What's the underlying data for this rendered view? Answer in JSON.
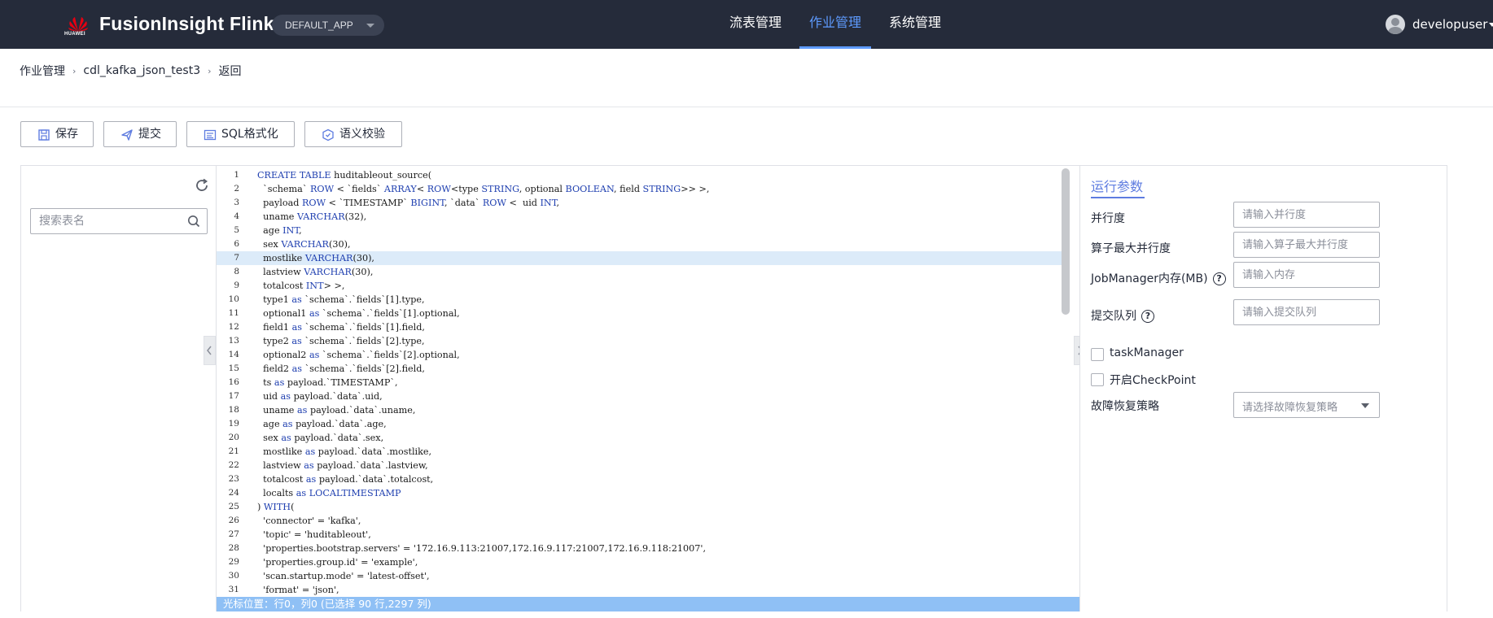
{
  "header": {
    "logo_text": "HUAWEI",
    "brand": "FusionInsight Flink",
    "app_selector": "DEFAULT_APP",
    "nav": [
      {
        "label": "流表管理",
        "active": false
      },
      {
        "label": "作业管理",
        "active": true
      },
      {
        "label": "系统管理",
        "active": false
      }
    ],
    "user": "developuser",
    "brand_color": "#252b3a",
    "accent_color": "#5e9bff"
  },
  "breadcrumb": [
    "作业管理",
    "cdl_kafka_json_test3",
    "返回"
  ],
  "toolbar": {
    "save": "保存",
    "submit": "提交",
    "sql_format": "SQL格式化",
    "semantic_check": "语义校验"
  },
  "left_panel": {
    "search_placeholder": "搜索表名"
  },
  "editor": {
    "highlighted_line": 7,
    "lines": [
      "CREATE TABLE huditableout_source(",
      "  `schema` ROW < `fields` ARRAY< ROW<type STRING, optional BOOLEAN, field STRING>> >,",
      "  payload ROW < `TIMESTAMP` BIGINT, `data` ROW <  uid INT,",
      "  uname VARCHAR(32),",
      "  age INT,",
      "  sex VARCHAR(30),",
      "  mostlike VARCHAR(30),",
      "  lastview VARCHAR(30),",
      "  totalcost INT> >,",
      "  type1 as `schema`.`fields`[1].type,",
      "  optional1 as `schema`.`fields`[1].optional,",
      "  field1 as `schema`.`fields`[1].field,",
      "  type2 as `schema`.`fields`[2].type,",
      "  optional2 as `schema`.`fields`[2].optional,",
      "  field2 as `schema`.`fields`[2].field,",
      "  ts as payload.`TIMESTAMP`,",
      "  uid as payload.`data`.uid,",
      "  uname as payload.`data`.uname,",
      "  age as payload.`data`.age,",
      "  sex as payload.`data`.sex,",
      "  mostlike as payload.`data`.mostlike,",
      "  lastview as payload.`data`.lastview,",
      "  totalcost as payload.`data`.totalcost,",
      "  localts as LOCALTIMESTAMP",
      ") WITH(",
      "  'connector' = 'kafka',",
      "  'topic' = 'huditableout',",
      "  'properties.bootstrap.servers' = '172.16.9.113:21007,172.16.9.117:21007,172.16.9.118:21007',",
      "  'properties.group.id' = 'example',",
      "  'scan.startup.mode' = 'latest-offset',",
      "  'format' = 'json',"
    ],
    "status": "光标位置：行0，列0 (已选择 90 行,2297 列)"
  },
  "run_params": {
    "title": "运行参数",
    "parallelism_label": "并行度",
    "parallelism_placeholder": "请输入并行度",
    "max_parallelism_label": "算子最大并行度",
    "max_parallelism_placeholder": "请输入算子最大并行度",
    "jm_memory_label": "JobManager内存(MB)",
    "jm_memory_placeholder": "请输入内存",
    "queue_label": "提交队列",
    "queue_placeholder": "请输入提交队列",
    "task_manager_label": "taskManager",
    "checkpoint_label": "开启CheckPoint",
    "restart_label": "故障恢复策略",
    "restart_placeholder": "请选择故障恢复策略"
  }
}
